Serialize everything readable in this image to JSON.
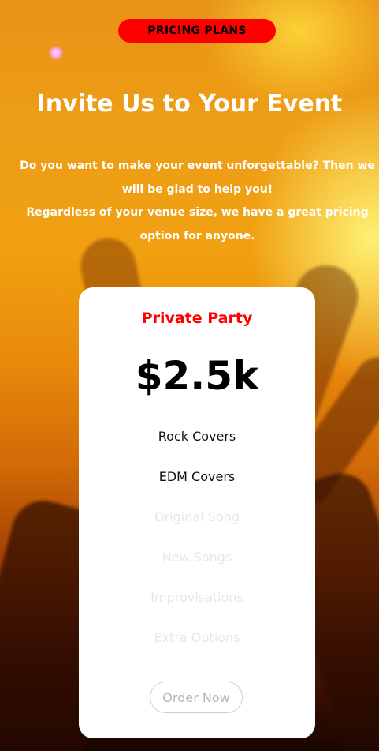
{
  "header": {
    "badge_label": "PRICING PLANS",
    "title": "Invite Us to Your Event",
    "intro_line1": "Do you want to make your event unforgettable? Then we will be glad to help you!",
    "intro_line2": "Regardless of your venue size, we have a great pricing option for anyone."
  },
  "plan": {
    "name": "Private Party",
    "price": "$2.5k",
    "features": [
      {
        "label": "Rock Covers",
        "included": true
      },
      {
        "label": "EDM Covers",
        "included": true
      },
      {
        "label": "Original Song",
        "included": false
      },
      {
        "label": "New Songs",
        "included": false
      },
      {
        "label": "Improvisations",
        "included": false
      },
      {
        "label": "Extra Options",
        "included": false
      }
    ],
    "order_label": "Order Now"
  },
  "colors": {
    "accent": "#ff0000",
    "card_bg": "#ffffff",
    "feature_included": "#111111",
    "feature_excluded": "#e7e7e7"
  }
}
